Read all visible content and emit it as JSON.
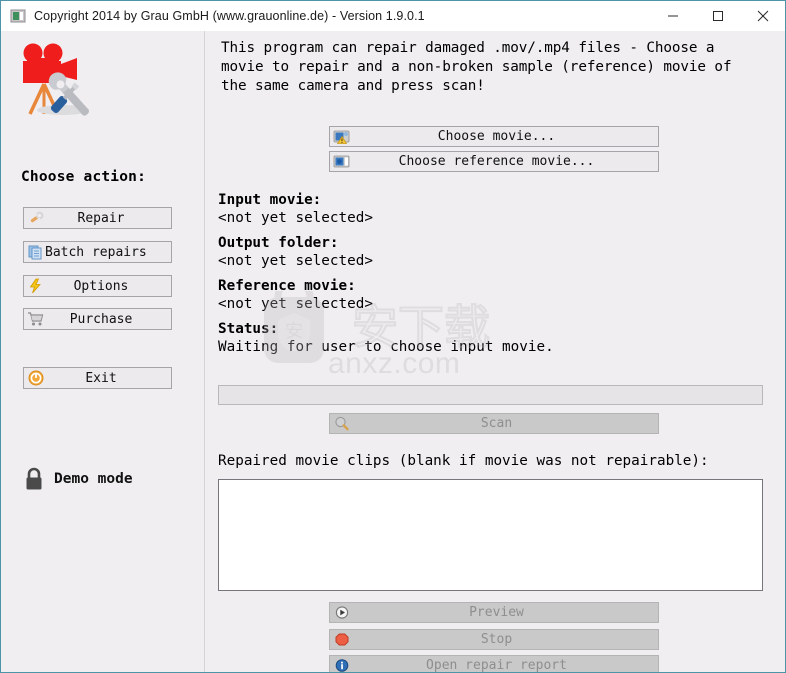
{
  "window": {
    "title": "Copyright 2014 by Grau GmbH (www.grauonline.de) - Version 1.9.0.1",
    "icon": "film-window-icon",
    "controls": {
      "minimize": "minimize-icon",
      "maximize": "maximize-icon",
      "close": "close-icon"
    },
    "accent_border": "#4d94a8",
    "background": "#f0eef1"
  },
  "sidebar": {
    "logo_icon": "movie-camera-repair-logo",
    "heading": "Choose action:",
    "buttons": [
      {
        "label": "Repair",
        "icon": "wrench-icon",
        "name": "repair-button"
      },
      {
        "label": "Batch repairs",
        "icon": "documents-icon",
        "name": "batch-repairs-button"
      },
      {
        "label": "Options",
        "icon": "lightning-icon",
        "name": "options-button"
      },
      {
        "label": "Purchase",
        "icon": "shopping-cart-icon",
        "name": "purchase-button"
      },
      {
        "label": "Exit",
        "icon": "power-icon",
        "name": "exit-button"
      }
    ],
    "status": {
      "icon": "padlock-icon",
      "label": "Demo mode"
    }
  },
  "main": {
    "intro": "This program can repair damaged .mov/.mp4 files - Choose a\nmovie to repair and a non-broken sample (reference) movie of\nthe same camera and press scan!",
    "choose_buttons": [
      {
        "label": "Choose movie...",
        "icon": "movie-warning-icon"
      },
      {
        "label": "Choose reference movie...",
        "icon": "movie-reference-icon"
      }
    ],
    "info": [
      {
        "label": "Input movie:",
        "value": "<not yet selected>"
      },
      {
        "label": "Output folder:",
        "value": "<not yet selected>"
      },
      {
        "label": "Reference movie:",
        "value": "<not yet selected>"
      },
      {
        "label": "Status:",
        "value": "Waiting for user to choose input movie."
      }
    ],
    "progress": {
      "percent": 0
    },
    "scan_button": {
      "label": "Scan",
      "icon": "magnifier-icon",
      "disabled": true
    },
    "clips_label": "Repaired movie clips (blank if movie was not repairable):",
    "clips_value": "",
    "action_buttons": [
      {
        "label": "Preview",
        "icon": "play-circle-icon",
        "disabled": true
      },
      {
        "label": "Stop",
        "icon": "stop-octagon-icon",
        "disabled": true
      },
      {
        "label": "Open repair report",
        "icon": "info-circle-icon",
        "disabled": true
      }
    ]
  },
  "watermark": {
    "site": "anxz.com",
    "mark": "安下载"
  }
}
